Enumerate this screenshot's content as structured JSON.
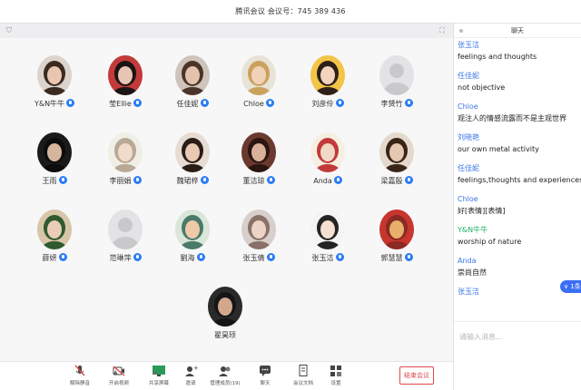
{
  "window": {
    "title": "腾讯会议  会议号：745 389 436"
  },
  "participants": [
    {
      "name": "Y&N牛牛",
      "bg": "#dcd4cc",
      "face": "#e8c6b0",
      "hair": "#3a2a22"
    },
    {
      "name": "莹Ellie",
      "bg": "#c23a3a",
      "face": "#e8c4b4",
      "hair": "#1c1414"
    },
    {
      "name": "任佳妮",
      "bg": "#cfc4bb",
      "face": "#e3c3ae",
      "hair": "#4a3427"
    },
    {
      "name": "Chloe",
      "bg": "#e7e3d6",
      "face": "#f0d2bb",
      "hair": "#caa15d"
    },
    {
      "name": "刘彦伶",
      "bg": "#f2c548",
      "face": "#f3d3bd",
      "hair": "#2e2018"
    },
    {
      "name": "李赟竹",
      "bg": "#e3e3e5",
      "face": "#c9c9cc",
      "hair": "#c9c9cc"
    },
    {
      "name": "王雨",
      "bg": "#1a1a1a",
      "face": "#d6b59d",
      "hair": "#0c0c0c"
    },
    {
      "name": "李丽娟",
      "bg": "#efefe6",
      "face": "#f1dccb",
      "hair": "#b8a894"
    },
    {
      "name": "魏珺梓",
      "bg": "#e6dcd4",
      "face": "#e9c8b4",
      "hair": "#2a1c16"
    },
    {
      "name": "董洁琼",
      "bg": "#6a3a2e",
      "face": "#d9b09a",
      "hair": "#2b1510"
    },
    {
      "name": "Anda",
      "bg": "#f6efe0",
      "face": "#f0d9c5",
      "hair": "#c23a3a"
    },
    {
      "name": "梁嘉殷",
      "bg": "#e4d9cc",
      "face": "#e6c7b1",
      "hair": "#3a2418"
    },
    {
      "name": "薛妍",
      "bg": "#d8c6a8",
      "face": "#e9cdb6",
      "hair": "#2e5a2e"
    },
    {
      "name": "范琳萍",
      "bg": "#e3e3e5",
      "face": "#c9c9cc",
      "hair": "#c9c9cc"
    },
    {
      "name": "劉海",
      "bg": "#d9e6d8",
      "face": "#f0c9a8",
      "hair": "#4a7a6a"
    },
    {
      "name": "张玉倩",
      "bg": "#d7cfcb",
      "face": "#ecd4c6",
      "hair": "#8a7168"
    },
    {
      "name": "张玉洁",
      "bg": "#f4f4f4",
      "face": "#f4dfd2",
      "hair": "#242424"
    },
    {
      "name": "郭慧慧",
      "bg": "#c8352f",
      "face": "#e8b06a",
      "hair": "#8a2a22"
    },
    {
      "name": "翟昊顼",
      "bg": "#2a2a2a",
      "face": "#d2a88c",
      "hair": "#151515"
    }
  ],
  "chat": {
    "title": "聊天",
    "messages": [
      {
        "sender": "张玉洁",
        "text": "feelings and thoughts"
      },
      {
        "sender": "任佳妮",
        "text": "not objective"
      },
      {
        "sender": "Chloe",
        "text": "观注人的情感流露而不是主观世界"
      },
      {
        "sender": "刘晓艳",
        "text": "our own metal  activity"
      },
      {
        "sender": "任佳妮",
        "text": "feelings,thoughts and experiences of"
      },
      {
        "sender": "Chloe",
        "text": "好[表情][表情]"
      },
      {
        "sender": "Y&N牛牛",
        "text": "worship of nature"
      },
      {
        "sender": "Anda",
        "text": "崇尚自然"
      }
    ],
    "partial_sender": "张玉洁",
    "new_badge": "∨ 1条",
    "input_placeholder": "请输入消息..."
  },
  "toolbar": {
    "items": [
      {
        "label": "解除静音",
        "icon": "microphone-muted-icon"
      },
      {
        "label": "开启视频",
        "icon": "camera-off-icon"
      },
      {
        "label": "共享屏幕",
        "icon": "screen-share-icon"
      },
      {
        "label": "邀请",
        "icon": "invite-icon"
      },
      {
        "label": "管理成员(19)",
        "icon": "members-icon"
      },
      {
        "label": "聊天",
        "icon": "chat-icon"
      },
      {
        "label": "会议文档",
        "icon": "document-icon"
      },
      {
        "label": "设置",
        "icon": "settings-icon"
      }
    ],
    "end_label": "结束会议",
    "end_color": "#e0474c"
  },
  "colors": {
    "accent": "#2b7cf6",
    "sender": "#3a77e6",
    "sender_alt": "#21b36b"
  }
}
